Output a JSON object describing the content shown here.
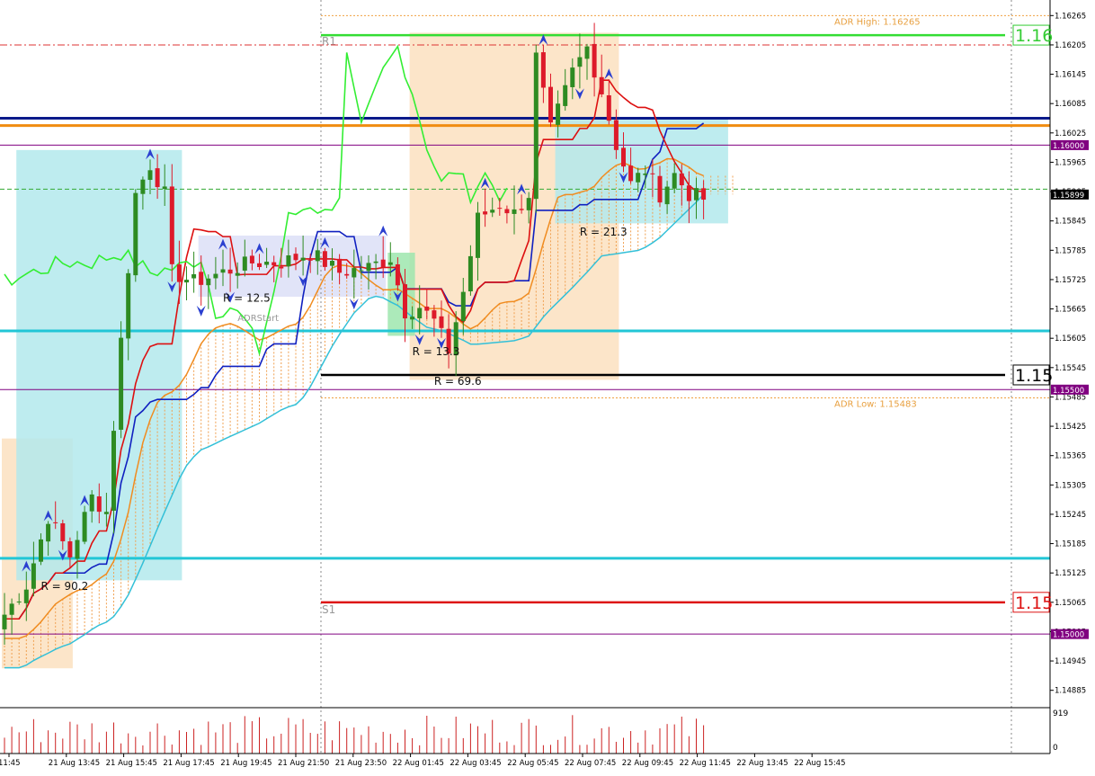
{
  "chart_data": {
    "type": "candlestick",
    "price_axis": {
      "ylim": [
        1.14855,
        1.16295
      ],
      "ticks": [
        "1.16265",
        "1.16205",
        "1.16145",
        "1.16085",
        "1.16025",
        "1.15965",
        "1.15905",
        "1.15845",
        "1.15785",
        "1.15725",
        "1.15665",
        "1.15605",
        "1.15545",
        "1.15485",
        "1.15425",
        "1.15365",
        "1.15305",
        "1.15245",
        "1.15185",
        "1.15125",
        "1.15065",
        "1.15005",
        "1.14945",
        "1.14885"
      ]
    },
    "time_axis": {
      "labels": [
        "11:45",
        "21 Aug 13:45",
        "21 Aug 15:45",
        "21 Aug 17:45",
        "21 Aug 19:45",
        "21 Aug 21:50",
        "21 Aug 23:50",
        "22 Aug 01:45",
        "22 Aug 03:45",
        "22 Aug 05:45",
        "22 Aug 07:45",
        "22 Aug 09:45",
        "22 Aug 11:45",
        "22 Aug 13:45",
        "22 Aug 15:45"
      ],
      "bar_count": 110
    },
    "price_tags": {
      "current": "1.15899",
      "level_a": "1.16000",
      "level_b": "1.15500",
      "level_c": "1.15000",
      "big_r1": "1.16",
      "big_mid": "1.15",
      "big_s1": "1.15"
    },
    "levels": [
      {
        "label": "ADR High: 1.16265",
        "price": 1.16265,
        "style": "dotted",
        "color": "#f0a040"
      },
      {
        "label": "ADR Low: 1.15483",
        "price": 1.15483,
        "style": "dotted",
        "color": "#f0a040"
      },
      {
        "label": "R1",
        "price": 1.16225,
        "style": "solid",
        "color": "#33dd33"
      },
      {
        "label": "S1",
        "price": 1.15065,
        "style": "solid",
        "color": "#dd1111"
      },
      {
        "label": "",
        "price": 1.16205,
        "style": "dashdot",
        "color": "#dd3333"
      },
      {
        "label": "",
        "price": 1.16055,
        "style": "solid",
        "color": "#0a1a8a"
      },
      {
        "label": "",
        "price": 1.1604,
        "style": "solid",
        "color": "#f08c10"
      },
      {
        "label": "",
        "price": 1.16,
        "style": "solid",
        "color": "#800080"
      },
      {
        "label": "",
        "price": 1.1591,
        "style": "dashed",
        "color": "#33aa33"
      },
      {
        "label": "",
        "price": 1.1562,
        "style": "solid",
        "color": "#22c6d6"
      },
      {
        "label": "",
        "price": 1.1553,
        "style": "solid",
        "color": "#000000"
      },
      {
        "label": "",
        "price": 1.155,
        "style": "solid",
        "color": "#800080"
      },
      {
        "label": "",
        "price": 1.15155,
        "style": "solid",
        "color": "#22c6d6"
      },
      {
        "label": "",
        "price": 1.15,
        "style": "solid",
        "color": "#800080"
      }
    ],
    "annotations": [
      {
        "text": "R = 90.2",
        "bar": 5,
        "price": 1.1509
      },
      {
        "text": "R = 12.5",
        "bar": 30,
        "price": 1.1568
      },
      {
        "text": "ADRStart",
        "bar": 32,
        "price": 1.1564
      },
      {
        "text": "R = 13.3",
        "bar": 56,
        "price": 1.1557
      },
      {
        "text": "R = 69.6",
        "bar": 59,
        "price": 1.1551
      },
      {
        "text": "R = 21.3",
        "bar": 79,
        "price": 1.15815
      }
    ],
    "boxes": [
      {
        "x0": 0,
        "x1": 9,
        "p0": 1.154,
        "p1": 1.1493,
        "color": "#fbe1c0"
      },
      {
        "x0": 2,
        "x1": 24,
        "p0": 1.1599,
        "p1": 1.1511,
        "color": "#b3e9ec"
      },
      {
        "x0": 27,
        "x1": 52,
        "p0": 1.15815,
        "p1": 1.1569,
        "color": "#dcdff7"
      },
      {
        "x0": 56,
        "x1": 84,
        "p0": 1.1623,
        "p1": 1.1552,
        "color": "#fbe1c0"
      },
      {
        "x0": 53,
        "x1": 56,
        "p0": 1.1578,
        "p1": 1.1561,
        "color": "#9ee6ae"
      },
      {
        "x0": 76,
        "x1": 99,
        "p0": 1.16055,
        "p1": 1.1584,
        "color": "#b3e9ec"
      }
    ],
    "volume": {
      "max_label": "919",
      "min_label": "0"
    }
  }
}
